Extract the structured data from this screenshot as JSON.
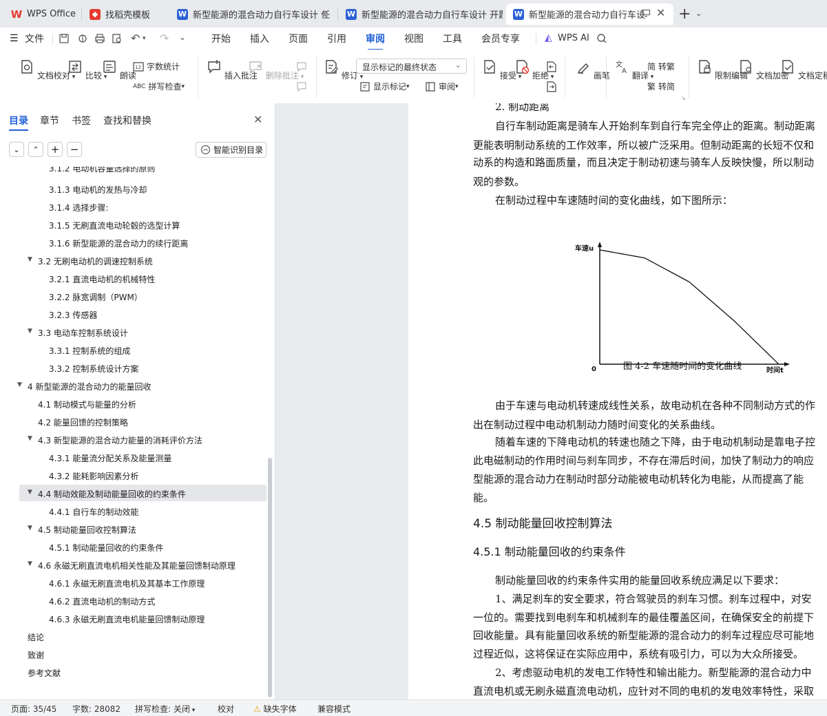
{
  "tabs": {
    "items": [
      {
        "label": "WPS Office"
      },
      {
        "label": "找稻壳模板"
      },
      {
        "label": "新型能源的混合动力自行车设计 任"
      },
      {
        "label": "新型能源的混合动力自行车设计 开题"
      },
      {
        "label": "新型能源的混合动力自行车设计"
      }
    ]
  },
  "menu": {
    "file": "文件",
    "items": [
      "开始",
      "插入",
      "页面",
      "引用",
      "审阅",
      "视图",
      "工具",
      "会员专享"
    ],
    "selected": "审阅",
    "ai": "WPS AI"
  },
  "ribbon": {
    "doc_check": "文档校对",
    "compare": "比较",
    "read": "朗读",
    "word_count": "字数统计",
    "spell_check": "拼写检查",
    "insert_comment": "插入批注",
    "delete_comment": "删除批注",
    "revise": "修订",
    "markup_state": "显示标记的最终状态",
    "show_markup": "显示标记",
    "review": "审阅",
    "accept": "接受",
    "reject": "拒绝",
    "pen": "画笔",
    "translate": "翻译",
    "to_traditional": "转繁",
    "to_simplified": "转简",
    "restrict_edit": "限制编辑",
    "doc_encrypt": "文档加密",
    "doc_finalize": "文档定稿"
  },
  "nav": {
    "tabs": [
      "目录",
      "章节",
      "书签",
      "查找和替换"
    ],
    "smart_toc": "智能识别目录",
    "toc": [
      {
        "text": "3.1.2  电动机容量选择的原则",
        "level": 3
      },
      {
        "text": "3.1.3  电动机的发热与冷却",
        "level": 3
      },
      {
        "text": "3.1.4  选择步骤:",
        "level": 3
      },
      {
        "text": "3.1.5  无刷直流电动轮毂的选型计算",
        "level": 3
      },
      {
        "text": "3.1.6  新型能源的混合动力的续行距离",
        "level": 3
      },
      {
        "text": "3.2  无刷电动机的调速控制系统",
        "level": 2,
        "arrow": true
      },
      {
        "text": "3.2.1  直流电动机的机械特性",
        "level": 3
      },
      {
        "text": "3.2.2  脉宽调制（PWM）",
        "level": 3
      },
      {
        "text": "3.2.3  传感器",
        "level": 3
      },
      {
        "text": "3.3  电动车控制系统设计",
        "level": 2,
        "arrow": true
      },
      {
        "text": "3.3.1  控制系统的组成",
        "level": 3
      },
      {
        "text": "3.3.2  控制系统设计方案",
        "level": 3
      },
      {
        "text": "4  新型能源的混合动力的能量回收",
        "level": 1,
        "arrow": true
      },
      {
        "text": "4.1  制动模式与能量的分析",
        "level": 2
      },
      {
        "text": "4.2  能量回馈的控制策略",
        "level": 2
      },
      {
        "text": "4.3  新型能源的混合动力能量的消耗评价方法",
        "level": 2,
        "arrow": true
      },
      {
        "text": "4.3.1  能量流分配关系及能量测量",
        "level": 3
      },
      {
        "text": "4.3.2  能耗影响因素分析",
        "level": 3
      },
      {
        "text": "4.4  制动效能及制动能量回收的约束条件",
        "level": 2,
        "arrow": true,
        "selected": true
      },
      {
        "text": "4.4.1  自行车的制动效能",
        "level": 3
      },
      {
        "text": "4.5  制动能量回收控制算法",
        "level": 2,
        "arrow": true
      },
      {
        "text": "4.5.1  制动能量回收的约束条件",
        "level": 3
      },
      {
        "text": "4.6  永磁无刷直流电机相关性能及其能量回馈制动原理",
        "level": 2,
        "arrow": true
      },
      {
        "text": "4.6.1  永磁无刷直流电机及其基本工作原理",
        "level": 3
      },
      {
        "text": "4.6.2  直流电动机的制动方式",
        "level": 3
      },
      {
        "text": "4.6.3  永磁无刷直流电机能量回馈制动原理",
        "level": 3
      },
      {
        "text": "结论",
        "level": 1
      },
      {
        "text": "致谢",
        "level": 1
      },
      {
        "text": "参考文献",
        "level": 1
      }
    ]
  },
  "doc": {
    "lines": [
      "2. 制动距离",
      "自行车制动距离是骑车人开始刹车到自行车完全停止的距离。制动距离",
      "更能表明制动系统的工作效率，所以被广泛采用。但制动距离的长短不仅和",
      "动系的构造和路面质量，而且决定于制动初速与骑车人反映快慢，所以制动",
      "观的参数。",
      "在制动过程中车速随时间的变化曲线，如下图所示：",
      "由于车速与电动机转速成线性关系，故电动机在各种不同制动方式的作",
      "出在制动过程中电动机制动力随时间变化的关系曲线。",
      "随着车速的下降电动机的转速也随之下降，由于电动机制动是靠电子控",
      "此电磁制动的作用时间与刹车同步，不存在滞后时间，加快了制动力的响应",
      "型能源的混合动力在制动时部分动能被电动机转化为电能，从而提高了能",
      "能。",
      "制动能量回收的约束条件实用的能量回收系统应满足以下要求：",
      "1、满足刹车的安全要求，符合驾驶员的刹车习惯。刹车过程中，对安",
      "一位的。需要找到电刹车和机械刹车的最佳覆盖区间，在确保安全的前提下",
      "回收能量。具有能量回收系统的新型能源的混合动力的刹车过程应尽可能地",
      "过程近似，这将保证在实际应用中，系统有吸引力，可以为大众所接受。",
      "2、考虑驱动电机的发电工作特性和输出能力。新型能源的混合动力中",
      "直流电机或无刷永磁直流电动机，应针对不同的电机的发电效率特性，采取"
    ],
    "heading_45": "4.5  制动能量回收控制算法",
    "heading_451": "4.5.1  制动能量回收的约束条件",
    "figure": {
      "ylabel": "车速u",
      "xlabel": "时间t",
      "origin": "0",
      "caption": "图 4-2  车速随时间的变化曲线"
    }
  },
  "chart_data": {
    "type": "line",
    "title": "图 4-2  车速随时间的变化曲线",
    "xlabel": "时间t",
    "ylabel": "车速u",
    "series": [
      {
        "x": [
          0,
          0.25,
          0.5,
          0.75,
          1.0
        ],
        "y": [
          1.0,
          0.93,
          0.72,
          0.38,
          0.0
        ]
      }
    ],
    "grid": false
  },
  "status": {
    "page": "页面: 35/45",
    "words": "字数: 28082",
    "spell": "拼写检查: 关闭",
    "proof": "校对",
    "missing_font": "缺失字体",
    "compat": "兼容模式"
  },
  "colors": {
    "accent": "#1f5fd8",
    "wps_red": "#e33b2e",
    "word_blue": "#2c62d6"
  }
}
